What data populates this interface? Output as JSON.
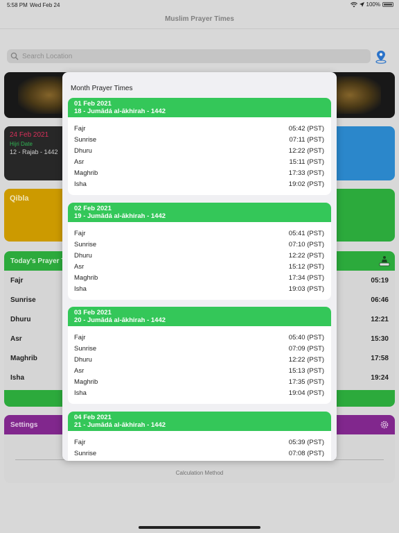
{
  "status_bar": {
    "time": "5:58 PM",
    "date": "Wed Feb 24",
    "battery": "100%"
  },
  "nav": {
    "title": "Muslim Prayer Times"
  },
  "search": {
    "placeholder": "Search Location"
  },
  "date_card": {
    "gregorian": "24 Feb 2021",
    "hijri_label": "Hijri Date",
    "hijri": "12 - Rajab - 1442"
  },
  "qibla_card": {
    "label": "Qibla"
  },
  "today": {
    "title": "Today's Prayer Times",
    "rows": [
      {
        "name": "Fajr",
        "time": "05:19"
      },
      {
        "name": "Sunrise",
        "time": "06:46"
      },
      {
        "name": "Dhuru",
        "time": "12:21"
      },
      {
        "name": "Asr",
        "time": "15:30"
      },
      {
        "name": "Maghrib",
        "time": "17:58"
      },
      {
        "name": "Isha",
        "time": "19:24"
      }
    ]
  },
  "settings": {
    "title": "Settings",
    "calc_method_label": "Calculation Method"
  },
  "modal": {
    "title": "Month Prayer Times",
    "days": [
      {
        "date": "01 Feb 2021",
        "hijri": "18 - Jumādá al-ākhirah - 1442",
        "rows": [
          {
            "name": "Fajr",
            "time": "05:42 (PST)"
          },
          {
            "name": "Sunrise",
            "time": "07:11 (PST)"
          },
          {
            "name": "Dhuru",
            "time": "12:22 (PST)"
          },
          {
            "name": "Asr",
            "time": "15:11 (PST)"
          },
          {
            "name": "Maghrib",
            "time": "17:33 (PST)"
          },
          {
            "name": "Isha",
            "time": "19:02 (PST)"
          }
        ]
      },
      {
        "date": "02 Feb 2021",
        "hijri": "19 - Jumādá al-ākhirah - 1442",
        "rows": [
          {
            "name": "Fajr",
            "time": "05:41 (PST)"
          },
          {
            "name": "Sunrise",
            "time": "07:10 (PST)"
          },
          {
            "name": "Dhuru",
            "time": "12:22 (PST)"
          },
          {
            "name": "Asr",
            "time": "15:12 (PST)"
          },
          {
            "name": "Maghrib",
            "time": "17:34 (PST)"
          },
          {
            "name": "Isha",
            "time": "19:03 (PST)"
          }
        ]
      },
      {
        "date": "03 Feb 2021",
        "hijri": "20 - Jumādá al-ākhirah - 1442",
        "rows": [
          {
            "name": "Fajr",
            "time": "05:40 (PST)"
          },
          {
            "name": "Sunrise",
            "time": "07:09 (PST)"
          },
          {
            "name": "Dhuru",
            "time": "12:22 (PST)"
          },
          {
            "name": "Asr",
            "time": "15:13 (PST)"
          },
          {
            "name": "Maghrib",
            "time": "17:35 (PST)"
          },
          {
            "name": "Isha",
            "time": "19:04 (PST)"
          }
        ]
      },
      {
        "date": "04 Feb 2021",
        "hijri": "21 - Jumādá al-ākhirah - 1442",
        "rows": [
          {
            "name": "Fajr",
            "time": "05:39 (PST)"
          },
          {
            "name": "Sunrise",
            "time": "07:08 (PST)"
          }
        ]
      }
    ]
  },
  "colors": {
    "green": "#34c759",
    "purple": "#8a2a96",
    "blue": "#2e90d8",
    "gold": "#d9a400",
    "pink": "#e63360"
  }
}
